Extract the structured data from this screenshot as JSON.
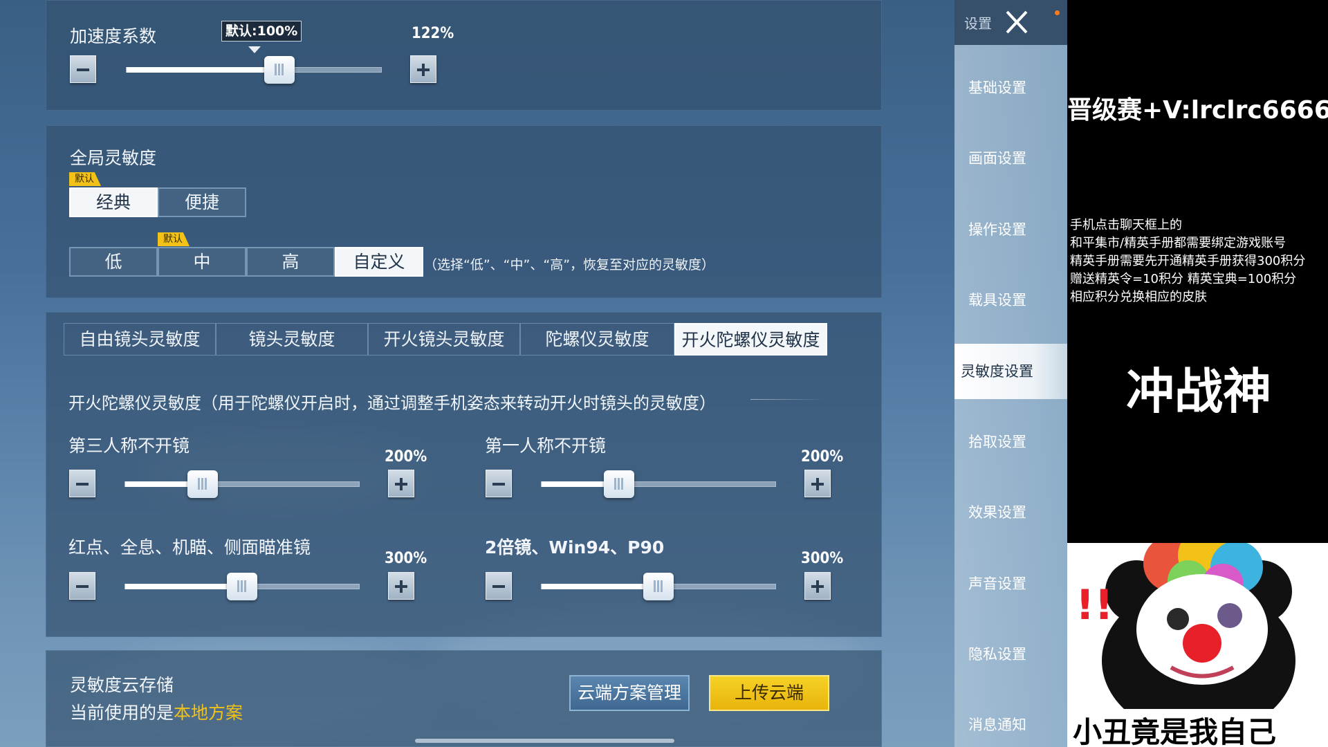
{
  "accel": {
    "label": "加速度系数",
    "default_tip": "默认:100%",
    "value_text": "122%",
    "value": 0.6
  },
  "global": {
    "title": "全局灵敏度",
    "default_badge": "默认",
    "modes": [
      "经典",
      "便捷"
    ],
    "levels": [
      "低",
      "中",
      "高",
      "自定义"
    ],
    "hint": "（选择“低”、“中”、“高”，恢复至对应的灵敏度）"
  },
  "tabs": [
    "自由镜头灵敏度",
    "镜头灵敏度",
    "开火镜头灵敏度",
    "陀螺仪灵敏度",
    "开火陀螺仪灵敏度"
  ],
  "section": {
    "desc": "开火陀螺仪灵敏度（用于陀螺仪开启时，通过调整手机姿态来转动开火时镜头的灵敏度）",
    "sliders": [
      {
        "label": "第三人称不开镜",
        "value_text": "200%",
        "value": 0.33
      },
      {
        "label": "第一人称不开镜",
        "value_text": "200%",
        "value": 0.33
      },
      {
        "label": "红点、全息、机瞄、侧面瞄准镜",
        "value_text": "300%",
        "value": 0.5
      },
      {
        "label": "2倍镜、Win94、P90",
        "value_text": "300%",
        "value": 0.5
      }
    ]
  },
  "cloud": {
    "title": "灵敏度云存储",
    "current_prefix": "当前使用的是",
    "current_value": "本地方案",
    "manage_button": "云端方案管理",
    "upload_button": "上传云端"
  },
  "menu": {
    "title": "设置",
    "items": [
      "基础设置",
      "画面设置",
      "操作设置",
      "载具设置",
      "灵敏度设置",
      "拾取设置",
      "效果设置",
      "声音设置",
      "隐私设置",
      "消息通知"
    ],
    "active_index": 4
  },
  "overlay": {
    "title": "晋级赛+V:lrclrc6666",
    "lines": [
      "手机点击聊天框上的",
      "和平集市/精英手册都需要绑定游戏账号",
      "精英手册需要先开通精英手册获得300积分",
      "赠送精英令=10积分 精英宝典=100积分",
      "相应积分兑换相应的皮肤"
    ],
    "big_text": "冲战神",
    "meme_caption": "小丑竟是我自己"
  },
  "colors": {
    "accent_yellow": "#f2c218",
    "panel": "#345270",
    "local_plan": "#f2c218"
  }
}
